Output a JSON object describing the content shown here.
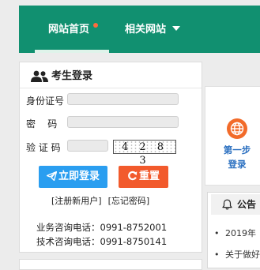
{
  "nav": {
    "home": "网站首页",
    "related": "相关网站"
  },
  "login": {
    "title": "考生登录",
    "id_label": "身份证号",
    "id_value": "",
    "password_label": "密    码",
    "password_value": "",
    "captcha_label": "验 证 码",
    "captcha_value": "",
    "captcha_text": "4 2 8 3",
    "login_button": "立即登录",
    "reset_button": "重置",
    "register_link": "[注册新用户]",
    "forgot_link": "[忘记密码]",
    "business_phone": "业务咨询电话：0991-8752001",
    "tech_phone": "技术咨询电话：0991-8750141"
  },
  "steps": {
    "step1_line1": "第一步",
    "step1_line2": "登录"
  },
  "notice": {
    "title": "公告",
    "items": [
      "2019年",
      "关于做好"
    ]
  },
  "colors": {
    "nav_bg": "#119070",
    "login_button": "#2a9ef0",
    "reset_button": "#f25a2c",
    "step_icon": "#f26b2a",
    "step_text": "#2a6fc0"
  }
}
